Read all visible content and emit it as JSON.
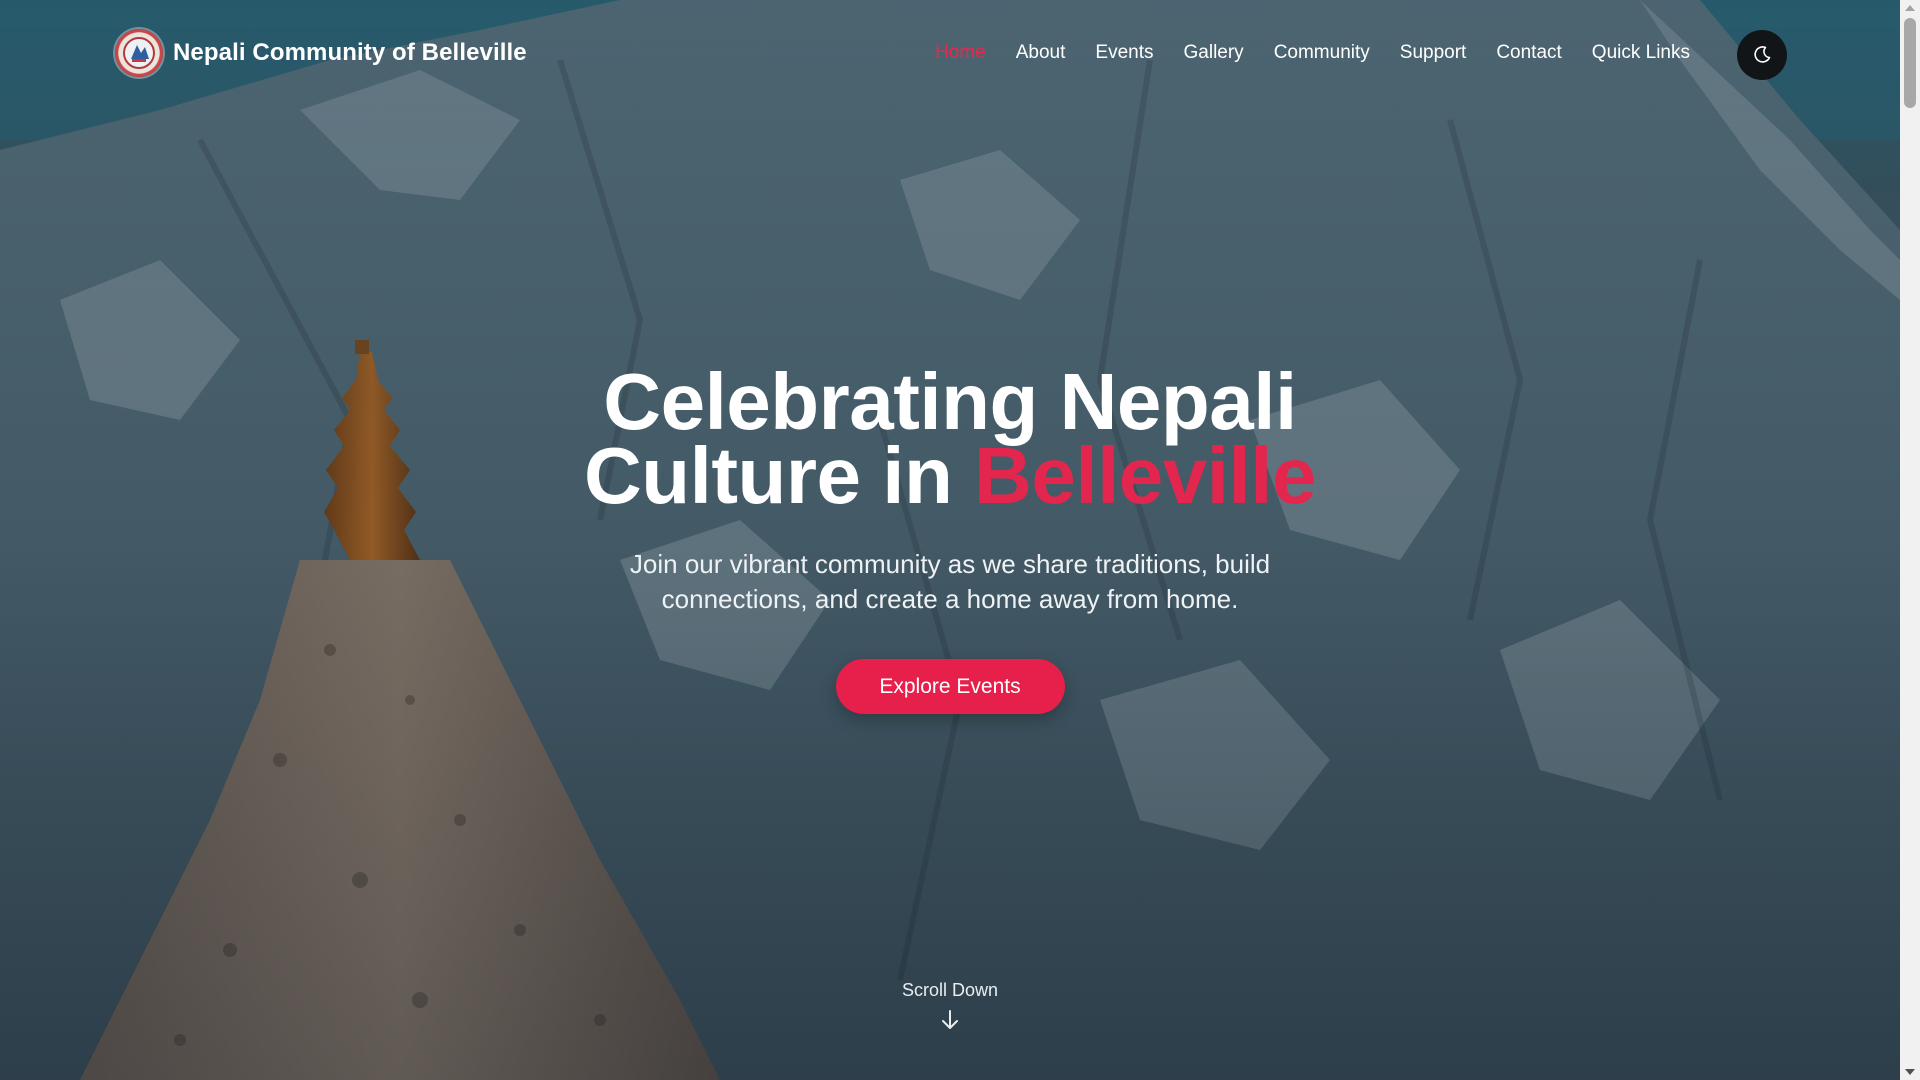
{
  "brand": {
    "name": "Nepali Community of Belleville"
  },
  "nav": {
    "items": [
      {
        "label": "Home",
        "active": true
      },
      {
        "label": "About"
      },
      {
        "label": "Events"
      },
      {
        "label": "Gallery"
      },
      {
        "label": "Community"
      },
      {
        "label": "Support"
      },
      {
        "label": "Contact"
      },
      {
        "label": "Quick Links"
      }
    ],
    "theme_toggle_icon": "moon-icon"
  },
  "hero": {
    "title_line1": "Celebrating Nepali",
    "title_line2_prefix": "Culture in ",
    "title_line2_accent": "Belleville",
    "subtitle": "Join our vibrant community as we share traditions, build connections, and create a home away from home.",
    "cta_label": "Explore Events"
  },
  "scroll_hint": {
    "label": "Scroll Down",
    "icon": "arrow-down-icon"
  },
  "colors": {
    "accent": "#e61f4b",
    "active_nav": "#e8284f",
    "text": "#ffffff",
    "toggle_bg": "#111518"
  }
}
